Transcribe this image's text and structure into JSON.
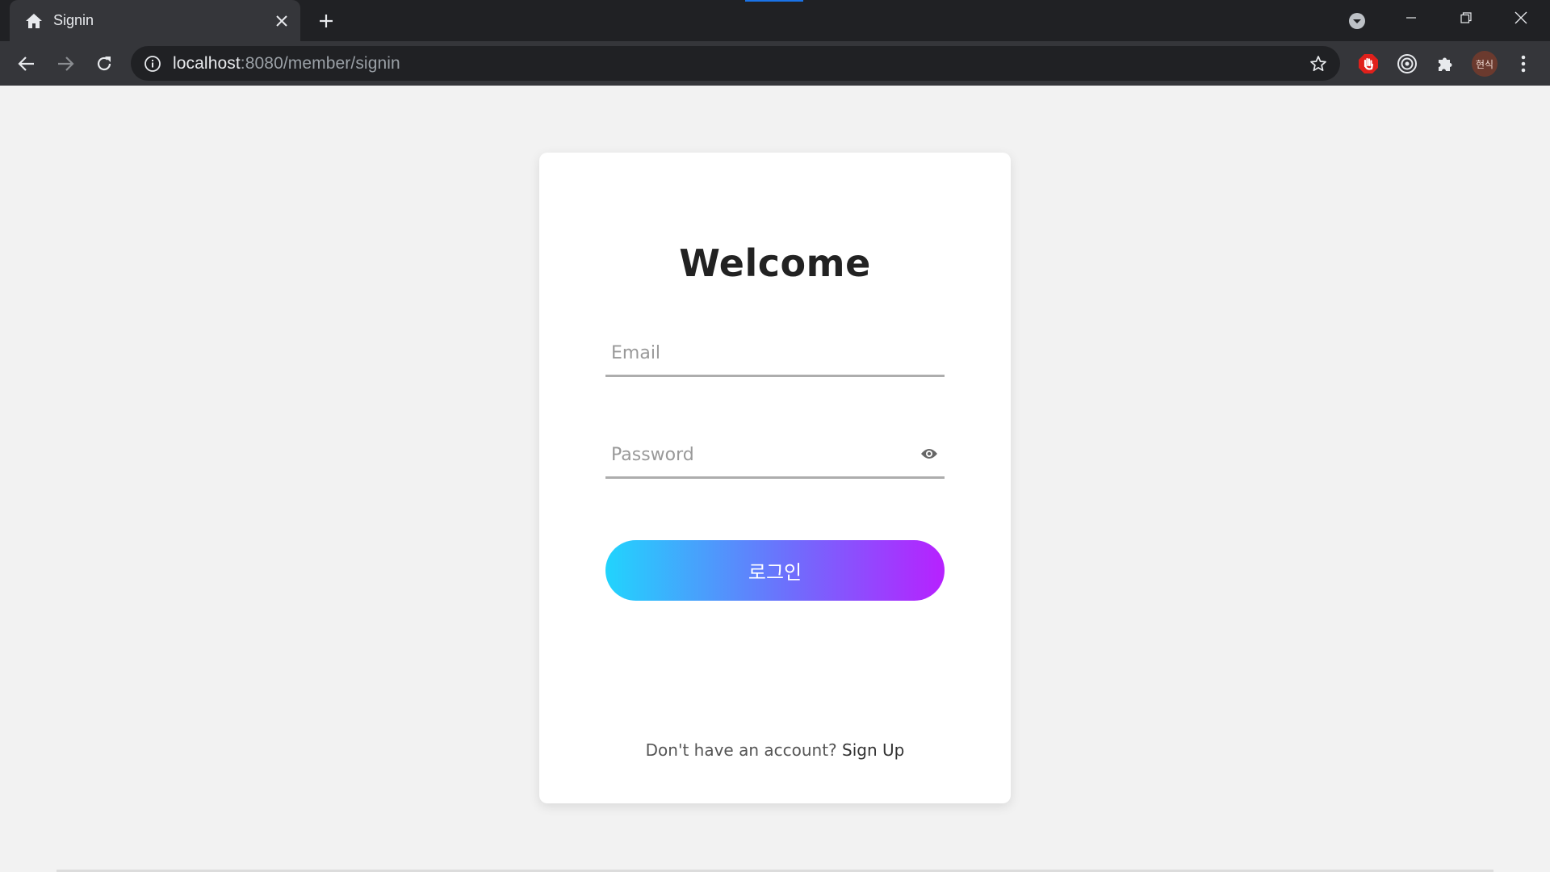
{
  "browser": {
    "tab": {
      "title": "Signin",
      "favicon": "home-icon"
    },
    "address": {
      "host": "localhost",
      "path": ":8080/member/signin"
    },
    "profile_initials": "현식",
    "icons": {
      "back": "arrow-left-icon",
      "forward": "arrow-right-icon",
      "reload": "reload-icon",
      "info": "info-icon",
      "bookmark": "star-icon",
      "extensions": [
        "stop-hand-icon",
        "target-icon",
        "puzzle-icon"
      ],
      "menu": "kebab-menu-icon"
    },
    "colors": {
      "frame": "#202124",
      "toolbar": "#35363a",
      "accent": "#1a73e8"
    }
  },
  "page": {
    "title": "Welcome",
    "email": {
      "placeholder": "Email",
      "value": ""
    },
    "password": {
      "placeholder": "Password",
      "value": ""
    },
    "login_label": "로그인",
    "signup_prompt": "Don't have an account?",
    "signup_link": "Sign Up",
    "colors": {
      "background": "#f2f2f2",
      "button_start": "#21d4fd",
      "button_end": "#b721ff",
      "underline": "#adadad"
    }
  }
}
